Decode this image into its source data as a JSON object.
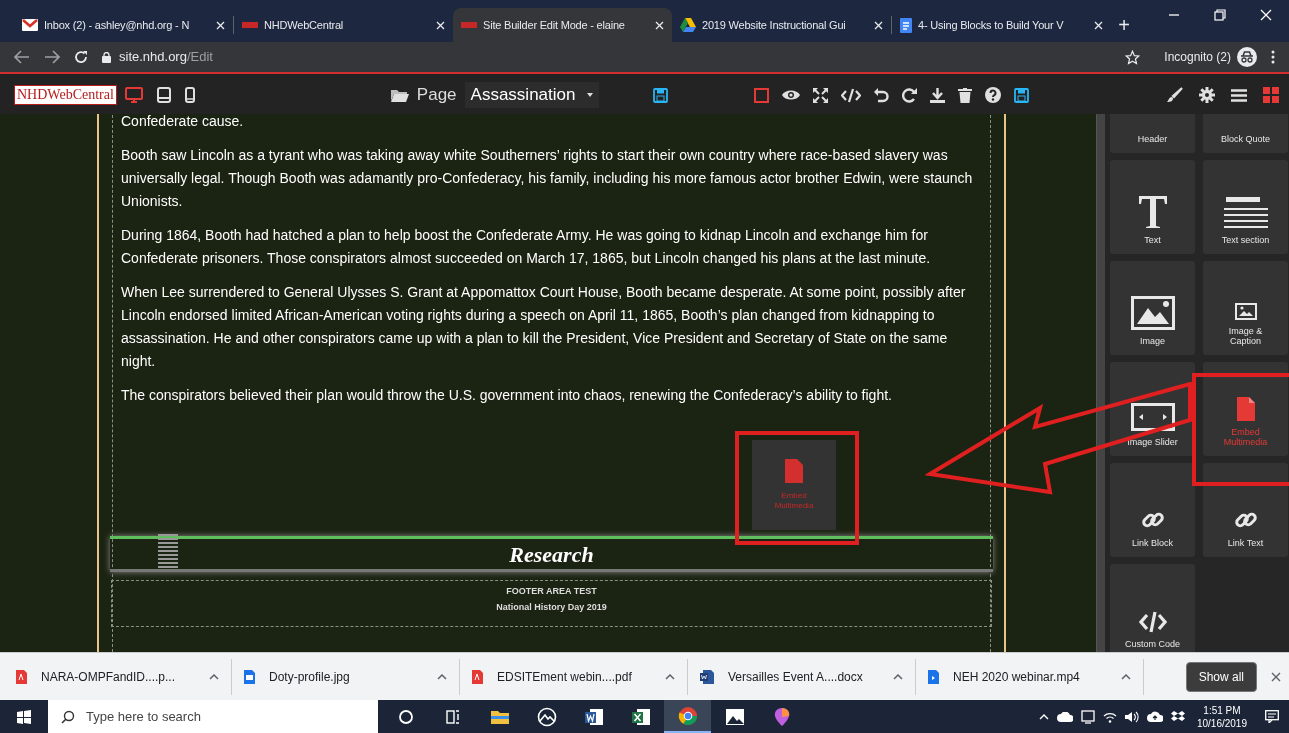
{
  "browser": {
    "tabs": [
      {
        "title": "Inbox (2) - ashley@nhd.org - N",
        "kind": "mail",
        "selected": false
      },
      {
        "title": "NHDWebCentral",
        "kind": "site",
        "selected": false
      },
      {
        "title": "Site Builder Edit Mode - elaine",
        "kind": "site",
        "selected": true
      },
      {
        "title": "2019 Website Instructional Gui",
        "kind": "drive",
        "selected": false
      },
      {
        "title": "4- Using Blocks to Build Your V",
        "kind": "doc",
        "selected": false
      }
    ],
    "new_tab": "+",
    "address": {
      "host": "site.nhd.org",
      "path": "/Edit"
    },
    "profile": "Incognito (2)"
  },
  "toolbar": {
    "logo": "NHDWebCentral",
    "devices": [
      {
        "kind": "desktop",
        "selected": true
      },
      {
        "kind": "tablet",
        "selected": false
      },
      {
        "kind": "phone",
        "selected": false
      }
    ],
    "page_label": "Page",
    "page_name": "Assassination"
  },
  "content": {
    "paragraphs": [
      "Confederate cause.",
      "Booth saw Lincoln as a tyrant who was taking away white Southerners’ rights to start their own country where race-based slavery was universally legal. Though Booth was adamantly pro-Confederacy, his family, including his more famous actor brother Edwin, were staunch Unionists.",
      "During 1864, Booth had hatched a plan to help boost the Confederate Army. He was going to kidnap Lincoln and exchange him for Confederate prisoners. Those conspirators almost succeeded on March 17, 1865, but Lincoln changed his plans at the last minute.",
      "When Lee surrendered to General Ulysses S. Grant at Appomattox Court House, Booth became desperate. At some point, possibly after Lincoln endorsed limited African-American voting rights during a speech on April 11, 1865, Booth’s plan changed from kidnapping to assassination. He and other conspirators came up with a plan to kill the President, Vice President and Secretary of State on the same night.",
      "The conspirators believed their plan would throw the U.S. government into chaos, renewing the Confederacy’s ability to fight."
    ],
    "banner": "Research",
    "footer": [
      "FOOTER AREA TEST",
      "National History Day 2019"
    ]
  },
  "dragged_block": {
    "label": "Embed Multimedia"
  },
  "blocks": [
    {
      "label": "Header",
      "kind": "plain",
      "selected": false
    },
    {
      "label": "Block Quote",
      "kind": "plain",
      "selected": false
    },
    {
      "label": "Text",
      "kind": "letter",
      "selected": false
    },
    {
      "label": "Text section",
      "kind": "lines",
      "selected": false
    },
    {
      "label": "Image",
      "kind": "image",
      "selected": false
    },
    {
      "label": "Image & Caption",
      "kind": "image-small",
      "selected": false
    },
    {
      "label": "Image Slider",
      "kind": "slider",
      "selected": false
    },
    {
      "label": "Embed Multimedia",
      "kind": "file",
      "selected": true
    },
    {
      "label": "Link Block",
      "kind": "link",
      "selected": false
    },
    {
      "label": "Link Text",
      "kind": "link",
      "selected": false
    },
    {
      "label": "Custom Code",
      "kind": "code",
      "selected": false
    }
  ],
  "downloads": {
    "files": [
      {
        "name": "NARA-OMPFandID....p...",
        "kind": "pdf"
      },
      {
        "name": "Doty-profile.jpg",
        "kind": "image"
      },
      {
        "name": "EDSITEment webin....pdf",
        "kind": "pdf"
      },
      {
        "name": "Versailles Event A....docx",
        "kind": "word"
      },
      {
        "name": "NEH 2020 webinar.mp4",
        "kind": "video"
      }
    ],
    "show_all": "Show all"
  },
  "taskbar": {
    "search_placeholder": "Type here to search",
    "time": "1:51 PM",
    "date": "10/16/2019"
  }
}
